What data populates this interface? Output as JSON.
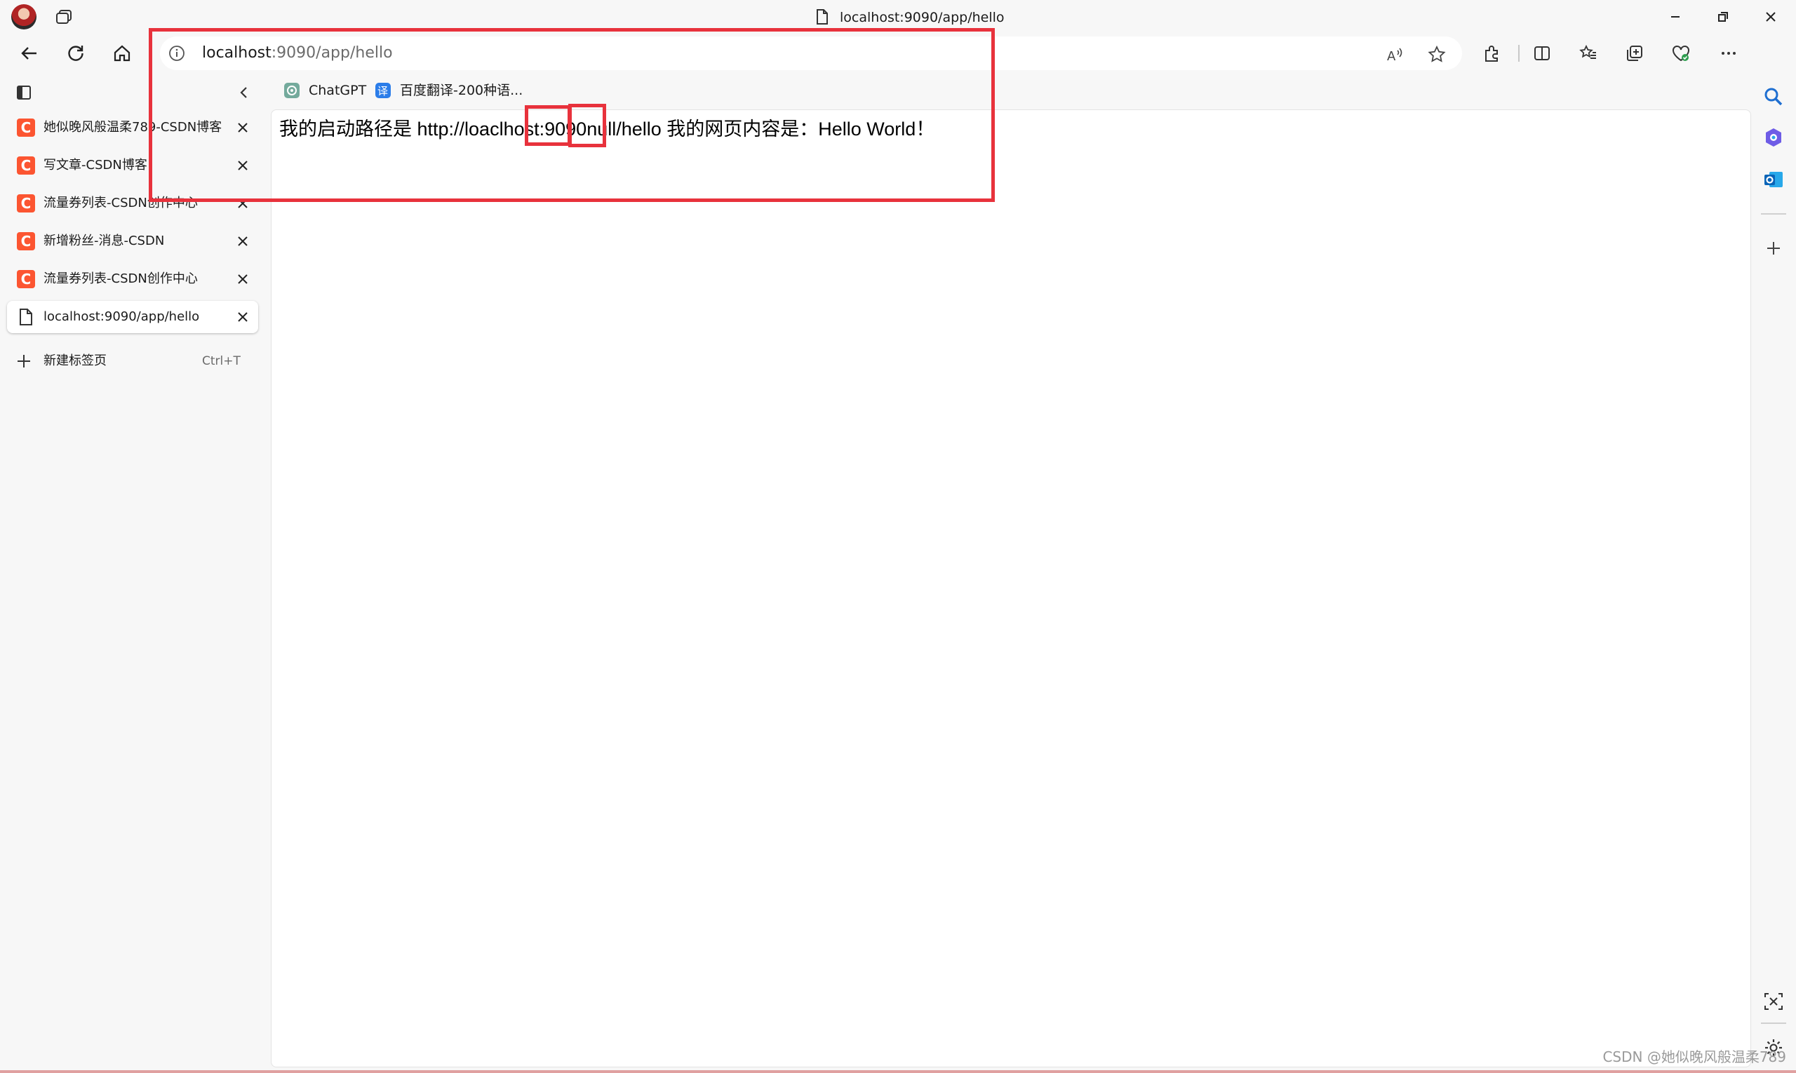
{
  "window": {
    "title": "localhost:9090/app/hello",
    "controls": [
      "minimize",
      "restore",
      "close"
    ]
  },
  "toolbar": {
    "buttons": [
      "back-icon",
      "refresh-icon",
      "home-icon",
      "read-aloud-icon",
      "favorite-star-icon",
      "extensions-icon",
      "split-screen-icon",
      "favorites-icon",
      "collections-icon",
      "browser-essentials-icon",
      "more-icon",
      "copilot-icon"
    ]
  },
  "address": {
    "host": "localhost",
    "path": ":9090/app/hello"
  },
  "favorites_bar": {
    "items": [
      {
        "label": "ChatGPT",
        "icon": "chatgpt-icon"
      },
      {
        "label": "百度翻译-200种语...",
        "icon": "baidu-translate-icon"
      }
    ]
  },
  "sidebar": {
    "tabs": [
      {
        "label": "她似晚风般温柔789-CSDN博客",
        "icon": "csdn-icon",
        "favicon_letter": "C",
        "active": false
      },
      {
        "label": "写文章-CSDN博客",
        "icon": "csdn-icon",
        "favicon_letter": "C",
        "active": false
      },
      {
        "label": "流量券列表-CSDN创作中心",
        "icon": "csdn-icon",
        "favicon_letter": "C",
        "active": false
      },
      {
        "label": "新增粉丝-消息-CSDN",
        "icon": "csdn-icon",
        "favicon_letter": "C",
        "active": false
      },
      {
        "label": "流量券列表-CSDN创作中心",
        "icon": "csdn-icon",
        "favicon_letter": "C",
        "active": false
      },
      {
        "label": "localhost:9090/app/hello",
        "icon": "document-icon",
        "active": true
      }
    ],
    "new_tab_label": "新建标签页",
    "new_tab_shortcut": "Ctrl+T"
  },
  "page": {
    "text_prefix": "我的启动路径是 http://loaclhost:",
    "port": "9090",
    "context": "null",
    "text_suffix": "/hello 我的网页内容是：Hello World！"
  },
  "watermark": "CSDN @她似晚风般温柔789",
  "colors": {
    "annotation_red": "#e8323c",
    "csdn_orange": "#fc5531",
    "copilot_blue": "#1f8ef1"
  }
}
